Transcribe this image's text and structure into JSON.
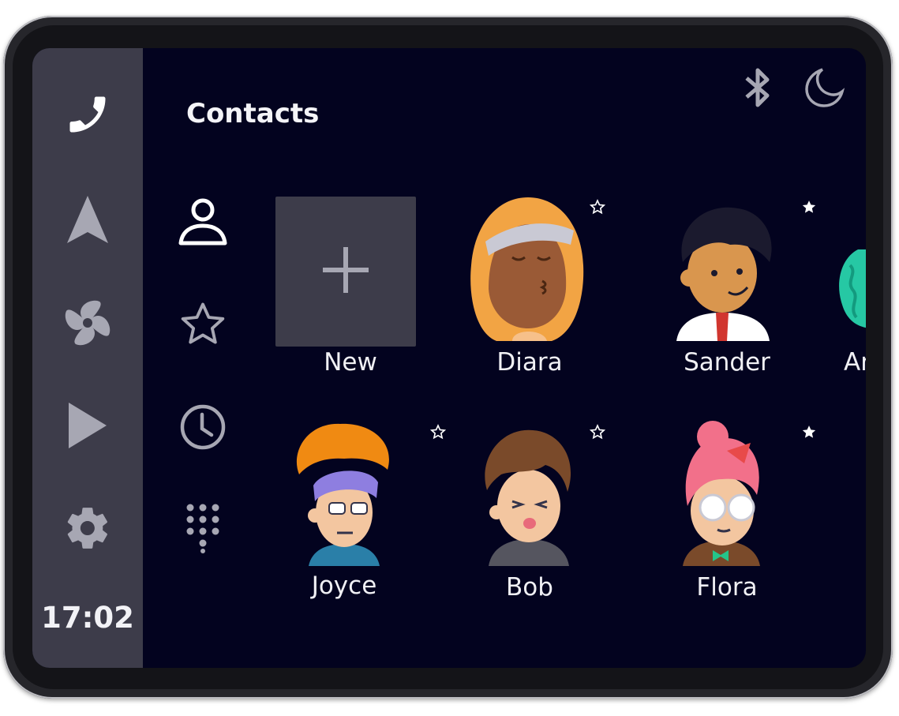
{
  "app": {
    "title": "Contacts",
    "clock": "17:02"
  },
  "nav_rail": {
    "items": [
      {
        "name": "phone-icon",
        "active": true
      },
      {
        "name": "navigation-icon",
        "active": false
      },
      {
        "name": "fan-icon",
        "active": false
      },
      {
        "name": "play-icon",
        "active": false
      },
      {
        "name": "gear-icon",
        "active": false
      }
    ]
  },
  "status": {
    "icons": [
      "bluetooth-icon",
      "moon-icon"
    ]
  },
  "filters": [
    {
      "name": "person-icon",
      "active": true
    },
    {
      "name": "star-icon",
      "active": false
    },
    {
      "name": "clock-icon",
      "active": false
    },
    {
      "name": "dialpad-icon",
      "active": false
    }
  ],
  "new_contact": {
    "label": "New"
  },
  "contacts": [
    {
      "name": "Diara",
      "favorite": false
    },
    {
      "name": "Sander",
      "favorite": true
    },
    {
      "name": "Ar",
      "favorite": false
    },
    {
      "name": "Joyce",
      "favorite": false
    },
    {
      "name": "Bob",
      "favorite": false
    },
    {
      "name": "Flora",
      "favorite": true
    }
  ],
  "colors": {
    "screen_bg": "#03031f",
    "rail_bg": "#3d3c4a",
    "icon_active": "#ffffff",
    "icon_inactive": "#a7a7b3",
    "text": "#f0f0f4"
  }
}
